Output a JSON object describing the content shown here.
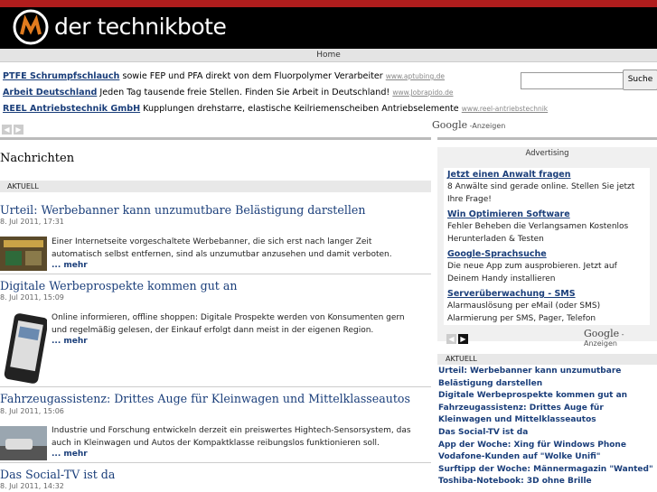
{
  "header": {
    "logo_text": "der technikbote",
    "nav_home": "Home"
  },
  "ads_top": [
    {
      "title": "PTFE Schrumpfschlauch",
      "text": " sowie FEP und PFA direkt von dem Fluorpolymer Verarbeiter ",
      "url": "www.aptubing.de"
    },
    {
      "title": "Arbeit Deutschland",
      "text": " Jeden Tag tausende freie Stellen. Finden Sie Arbeit in Deutschland! ",
      "url": "www.Jobrapido.de"
    },
    {
      "title": "REEL Antriebstechnik GmbH",
      "text": " Kupplungen drehstarre, elastische Keilriemenscheiben Antriebselemente ",
      "url": "www.reel-antriebstechnik"
    }
  ],
  "google_ads_label": {
    "brand": "Google",
    "suffix": "-Anzeigen"
  },
  "search": {
    "value": "",
    "button": "Suche"
  },
  "main": {
    "section_title": "Nachrichten",
    "aktuell": "AKTUELL",
    "more": "... mehr",
    "articles": [
      {
        "title": "Urteil: Werbebanner kann unzumutbare Belästigung darstellen",
        "date": "8. Jul 2011, 17:31",
        "text": "Einer Internetseite vorgeschaltete Werbebanner, die sich erst nach langer Zeit automatisch selbst entfernen, sind als unzumutbar anzusehen und damit verboten."
      },
      {
        "title": "Digitale Werbeprospekte kommen gut an",
        "date": "8. Jul 2011, 15:09",
        "text": "Online informieren, offline shoppen: Digitale Prospekte werden von Konsumenten gern und regelmäßig gelesen, der Einkauf erfolgt dann meist in der eigenen Region."
      },
      {
        "title": "Fahrzeugassistenz: Drittes Auge für Kleinwagen und Mittelklasseautos",
        "date": "8. Jul 2011, 15:06",
        "text": "Industrie und Forschung entwickeln derzeit ein preiswertes Hightech-Sensorsystem, das auch in Kleinwagen und Autos der Kompaktklasse reibungslos funktionieren soll."
      },
      {
        "title": "Das Social-TV ist da",
        "date": "8. Jul 2011, 14:32",
        "text": ""
      }
    ]
  },
  "advertising": {
    "label": "Advertising",
    "ads": [
      {
        "title": "Jetzt einen Anwalt fragen",
        "text": "8 Anwälte sind gerade online. Stellen Sie jetzt Ihre Frage!"
      },
      {
        "title": "Win Optimieren Software",
        "text": "Fehler Beheben die Verlangsamen Kostenlos Herunterladen & Testen"
      },
      {
        "title": "Google-Sprachsuche",
        "text": "Die neue App zum ausprobieren. Jetzt auf Deinem Handy installieren"
      },
      {
        "title": "Serverüberwachung - SMS",
        "text": "Alarmauslösung per eMail (oder SMS) Alarmierung per SMS, Pager, Telefon"
      }
    ]
  },
  "sidebar": {
    "aktuell": "AKTUELL",
    "items": [
      "Urteil: Werbebanner kann unzumutbare Belästigung darstellen",
      "Digitale Werbeprospekte kommen gut an",
      "Fahrzeugassistenz: Drittes Auge für Kleinwagen und Mittelklasseautos",
      "Das Social-TV ist da",
      "App der Woche: Xing für Windows Phone",
      "Vodafone-Kunden auf \"Wolke Unifi\"",
      "Surftipp der Woche: Männermagazin \"Wanted\"",
      "Toshiba-Notebook: 3D ohne Brille"
    ]
  },
  "colors": {
    "topbar": "#b01d1d",
    "header_bg": "#000000",
    "link": "#1a3e7a"
  }
}
